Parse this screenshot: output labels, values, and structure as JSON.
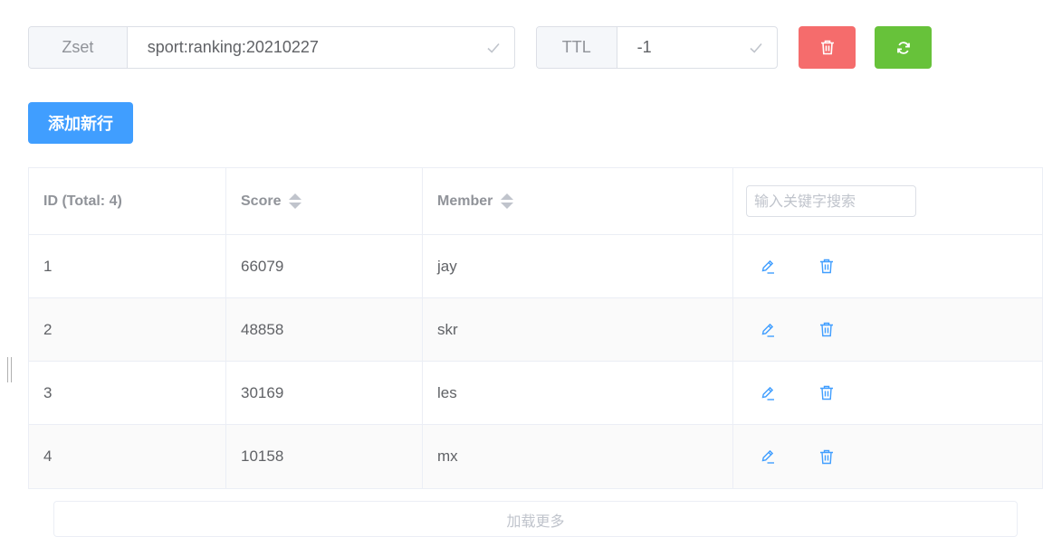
{
  "key": {
    "type_label": "Zset",
    "name": "sport:ranking:20210227"
  },
  "ttl": {
    "label": "TTL",
    "value": "-1"
  },
  "actions": {
    "delete_icon": "trash-icon",
    "refresh_icon": "refresh-icon",
    "add_row_label": "添加新行"
  },
  "colors": {
    "danger": "#f56c6c",
    "success": "#67c23a",
    "primary": "#409eff",
    "icon_blue": "#409eff"
  },
  "table": {
    "columns": {
      "id": "ID (Total: 4)",
      "score": "Score",
      "member": "Member"
    },
    "search_placeholder": "输入关键字搜索",
    "rows": [
      {
        "id": "1",
        "score": "66079",
        "member": "jay"
      },
      {
        "id": "2",
        "score": "48858",
        "member": "skr"
      },
      {
        "id": "3",
        "score": "30169",
        "member": "les"
      },
      {
        "id": "4",
        "score": "10158",
        "member": "mx"
      }
    ]
  },
  "load_more": {
    "label": "加载更多"
  }
}
